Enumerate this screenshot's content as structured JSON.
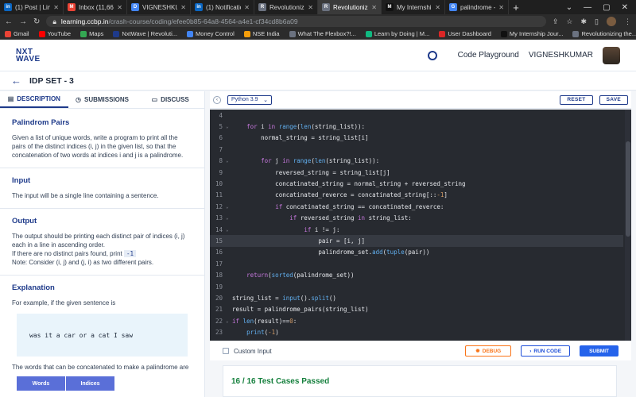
{
  "browser": {
    "tabs": [
      {
        "label": "(1) Post | LinkedIn",
        "icon": "linkedin-icon",
        "color": "#0a66c2",
        "glyph": "in",
        "active": false
      },
      {
        "label": "Inbox (11,662) - v",
        "icon": "gmail-icon",
        "color": "#ea4335",
        "glyph": "M",
        "active": false
      },
      {
        "label": "VIGNESHKUMAR",
        "icon": "doc-icon",
        "color": "#4285f4",
        "glyph": "D",
        "active": false
      },
      {
        "label": "(1) Notifications | L",
        "icon": "linkedin-icon",
        "color": "#0a66c2",
        "glyph": "in",
        "active": false
      },
      {
        "label": "Revolutionizing the",
        "icon": "page-icon",
        "color": "#6b7280",
        "glyph": "R",
        "active": false
      },
      {
        "label": "Revolutionizing th",
        "icon": "page-icon",
        "color": "#6b7280",
        "glyph": "R",
        "active": true
      },
      {
        "label": "My Internship Jour",
        "icon": "medium-icon",
        "color": "#111111",
        "glyph": "M",
        "active": false
      },
      {
        "label": "palindrome - Goog",
        "icon": "google-icon",
        "color": "#4285f4",
        "glyph": "G",
        "active": false
      }
    ],
    "url_host": "learning.ccbp.in",
    "url_path": "/crash-course/coding/efee0b85-64a8-4564-a4e1-cf34cd8b6a09",
    "bookmarks": [
      {
        "label": "Gmail",
        "color": "#ea4335"
      },
      {
        "label": "YouTube",
        "color": "#ff0000"
      },
      {
        "label": "Maps",
        "color": "#34a853"
      },
      {
        "label": "NxtWave | Revoluti...",
        "color": "#1e3a8a"
      },
      {
        "label": "Money Control",
        "color": "#4285f4"
      },
      {
        "label": "NSE India",
        "color": "#f59e0b"
      },
      {
        "label": "What The Flexbox?!...",
        "color": "#6b7280"
      },
      {
        "label": "Learn by Doing | M...",
        "color": "#10b981"
      },
      {
        "label": "User Dashboard",
        "color": "#dc2626"
      },
      {
        "label": "My Internship Jour...",
        "color": "#111111"
      },
      {
        "label": "Revolutionizing the...",
        "color": "#6b7280"
      },
      {
        "label": "Google Keep",
        "color": "#fbbc04"
      }
    ]
  },
  "header": {
    "logo_line1": "NXT",
    "logo_line2": "WAVE",
    "playground": "Code Playground",
    "username": "VIGNESHKUMAR"
  },
  "title": "IDP SET - 3",
  "left": {
    "tabs": [
      "DESCRIPTION",
      "SUBMISSIONS",
      "DISCUSS"
    ],
    "problem_title": "Palindrom Pairs",
    "problem_desc": "Given a list of unique words, write a program to print all the pairs of the distinct indices (i, j) in the given list, so that the concatenation of two words at indices i and j is a palindrome.",
    "input_title": "Input",
    "input_desc": "The input will be a single line containing a sentence.",
    "output_title": "Output",
    "output_desc": "The output should be printing each distinct pair of indices (i, j) each in a line in ascending order.",
    "output_note_pre": "If there are no distinct pairs found, print",
    "output_note_code": "-1",
    "output_note2": "Note: Consider (i, j) and (j, i) as two different pairs.",
    "explanation_title": "Explanation",
    "explanation_desc": "For example, if the given sentence is",
    "example_sentence": "was it a car or a cat I saw",
    "explanation_after": "The words that can be concatenated to make a palindrome are",
    "table_headers": [
      "Words",
      "Indices"
    ]
  },
  "editor": {
    "language": "Python 3.9",
    "reset": "RESET",
    "save": "SAVE"
  },
  "bottom": {
    "custom_input": "Custom Input",
    "debug": "DEBUG",
    "run": "RUN CODE",
    "submit": "SUBMIT"
  },
  "result": "16 / 16 Test Cases Passed"
}
